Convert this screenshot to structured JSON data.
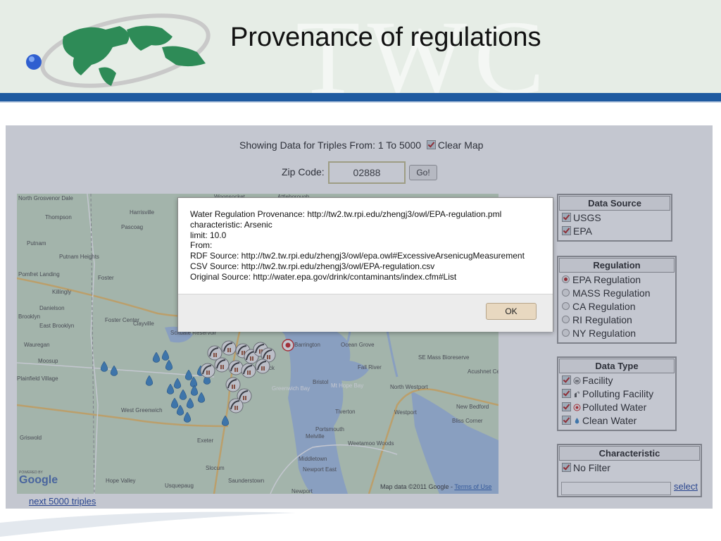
{
  "slide": {
    "title": "Provenance of regulations",
    "watermark": "TWC"
  },
  "app": {
    "showing_text": "Showing Data for Triples From: 1 To 5000",
    "clear_map_label": "Clear Map",
    "clear_map_checked": true,
    "zip_label": "Zip Code:",
    "zip_value": "02888",
    "go_label": "Go!",
    "next_link": "next 5000 triples"
  },
  "map": {
    "labels": [
      "North Grosvenor Dale",
      "Thompson",
      "Harrisville",
      "Pascoag",
      "Putnam",
      "Putnam Heights",
      "Pomfret Landing",
      "Foster",
      "Killingly",
      "Danielson",
      "Brooklyn",
      "East Brooklyn",
      "Foster Center",
      "Clayville",
      "Scituate Reservoir",
      "Wauregan",
      "Moosup",
      "Plainfield Village",
      "West Greenwich",
      "Griswold",
      "Exeter",
      "Slocum",
      "Hope Valley",
      "Usquepaug",
      "Saunderstown",
      "Newport",
      "Middletown",
      "Newport East",
      "Portsmouth",
      "Tiverton",
      "Westport",
      "Bliss Corner",
      "New Bedford",
      "North Westport",
      "Fall River",
      "Barrington",
      "Ocean Grove",
      "SE Mass Bioreserve",
      "Acushnet Center",
      "Warwick",
      "Bristol",
      "Mt Hope Bay",
      "Greenwich Bay",
      "Melville",
      "Weetamoo Woods",
      "Attleborough",
      "Woonsocket"
    ],
    "map_data_text": "Map data ©2011 Google -",
    "terms_text": "Terms of Use",
    "google_text": "Google",
    "powered_text": "POWERED BY"
  },
  "panels": {
    "data_source": {
      "title": "Data Source",
      "items": [
        {
          "label": "USGS",
          "checked": true
        },
        {
          "label": "EPA",
          "checked": true
        }
      ]
    },
    "regulation": {
      "title": "Regulation",
      "items": [
        {
          "label": "EPA Regulation",
          "selected": true
        },
        {
          "label": "MASS Regulation",
          "selected": false
        },
        {
          "label": "CA Regulation",
          "selected": false
        },
        {
          "label": "RI Regulation",
          "selected": false
        },
        {
          "label": "NY Regulation",
          "selected": false
        }
      ]
    },
    "data_type": {
      "title": "Data Type",
      "items": [
        {
          "label": "Facility",
          "checked": true,
          "icon": "facility-icon"
        },
        {
          "label": "Polluting Facility",
          "checked": true,
          "icon": "polluting-facility-icon"
        },
        {
          "label": "Polluted Water",
          "checked": true,
          "icon": "polluted-water-icon"
        },
        {
          "label": "Clean Water",
          "checked": true,
          "icon": "clean-water-icon"
        }
      ]
    },
    "characteristic": {
      "title": "Characteristic",
      "items": [
        {
          "label": "No Filter",
          "checked": true
        }
      ],
      "input_value": "",
      "select_label": "select"
    }
  },
  "dialog": {
    "lines": [
      "Water Regulation Provenance: http://tw2.tw.rpi.edu/zhengj3/owl/EPA-regulation.pml",
      "characteristic: Arsenic",
      "limit: 10.0",
      "From:",
      "RDF Source: http://tw2.tw.rpi.edu/zhengj3/owl/epa.owl#ExcessiveArsenicugMeasurement",
      "CSV Source: http://tw2.tw.rpi.edu/zhengj3/owl/EPA-regulation.csv",
      "Original Source: http://water.epa.gov/drink/contaminants/index.cfm#List"
    ],
    "ok_label": "OK"
  },
  "colors": {
    "header_band": "#1f5aa0",
    "header_bg": "#e6ede6",
    "water": "#a9c4e8",
    "land": "#cfe3c9",
    "clean_water_marker": "#3a86c8",
    "polluting_marker": "#666666",
    "check_mark": "#b02020"
  }
}
